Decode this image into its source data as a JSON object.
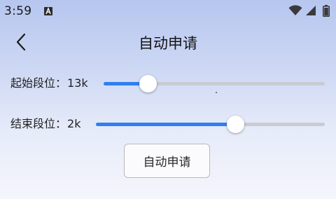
{
  "status_bar": {
    "time": "3:59",
    "icons": [
      "notification-a-icon",
      "wifi-icon",
      "signal-icon",
      "battery-icon"
    ]
  },
  "header": {
    "back_icon": "chevron-left-icon",
    "title": "自动申请"
  },
  "sliders": {
    "start": {
      "label": "起始段位：",
      "value": "13k",
      "fraction": 0.2
    },
    "end": {
      "label": "结束段位：",
      "value": "2k",
      "fraction": 0.61
    }
  },
  "apply_button": {
    "label": "自动申请"
  },
  "colors": {
    "accent": "#2f7ff0",
    "track": "#c9cbd3",
    "thumb": "#ffffff",
    "background_top": "#b6c6ef",
    "background_bottom": "#f5f6fc"
  }
}
